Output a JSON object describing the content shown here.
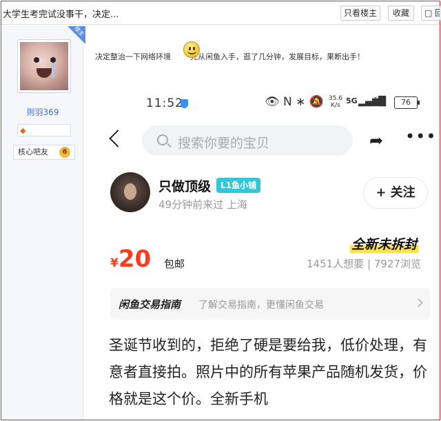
{
  "thread": {
    "title": "大学生考完试没事干，决定...",
    "only_op_label": "只看楼主",
    "favorite_label": "收藏",
    "reply_label": "回复"
  },
  "author": {
    "name": "则羽369",
    "op_badge": "楼主",
    "level_icon": "level-icon",
    "group_label": "核心吧友",
    "group_level": "6"
  },
  "post": {
    "text_before_emoji": "决定整治一下网络环境",
    "emoji": "smiley-emoji",
    "text_after_emoji": "先从闲鱼入手，逛了几分钟，发展目标，果断出手！"
  },
  "screenshot": {
    "status": {
      "time": "11:52",
      "icons": "👁 N ∗ 🔕",
      "speed_top": "35.6",
      "speed_bottom": "K/s",
      "network": "5G",
      "signal": "▂▄▆█",
      "no_signal": "ˣll",
      "battery": "76"
    },
    "search_placeholder": "搜索你要的宝贝",
    "seller": {
      "name": "只做顶级",
      "tag": "L1鱼小铺",
      "subtitle": "49分钟前来过  上海",
      "follow_label": "+ 关注"
    },
    "listing": {
      "currency": "¥",
      "price": "20",
      "shipping": "包邮",
      "condition": "全新未拆封",
      "stats": "1451人想要 | 7927浏览"
    },
    "guide": {
      "title": "闲鱼交易指南",
      "desc": "了解交易指南，更懂闲鱼交易"
    },
    "description": "圣诞节收到的，拒绝了硬是要给我，低价处理，有意者直接拍。照片中的所有苹果产品随机发货，价格就是这个价。全新手机"
  },
  "colors": {
    "frame_border": "#e0242b",
    "username": "#3a6fcf",
    "price": "#ff3b1f",
    "seller_tag": "#32c7d8",
    "condition_highlight": "#ffe14a"
  }
}
